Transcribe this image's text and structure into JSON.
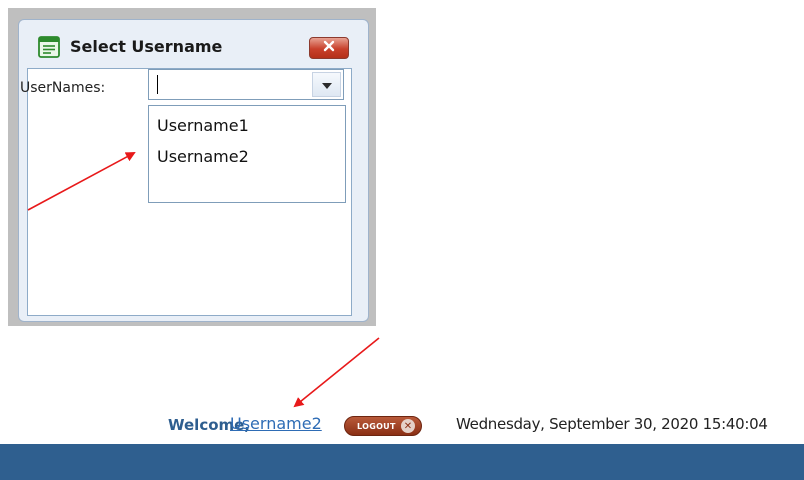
{
  "dialog": {
    "title": "Select Username",
    "title_icon": "form-icon",
    "close_icon": "close-icon",
    "field_label": "UserNames:",
    "input_value": "",
    "dropdown_icon": "chevron-down-icon",
    "options": [
      {
        "label": "Username1"
      },
      {
        "label": "Username2"
      }
    ]
  },
  "header": {
    "welcome_label": "Welcome,",
    "username": "Username2",
    "logout_label": "LOGOUT",
    "logout_icon": "close-icon",
    "datetime": "Wednesday, September 30, 2020 15:40:04",
    "bar_color": "#2f5f8f"
  },
  "annotations": {
    "arrow_color": "#e8191a"
  }
}
